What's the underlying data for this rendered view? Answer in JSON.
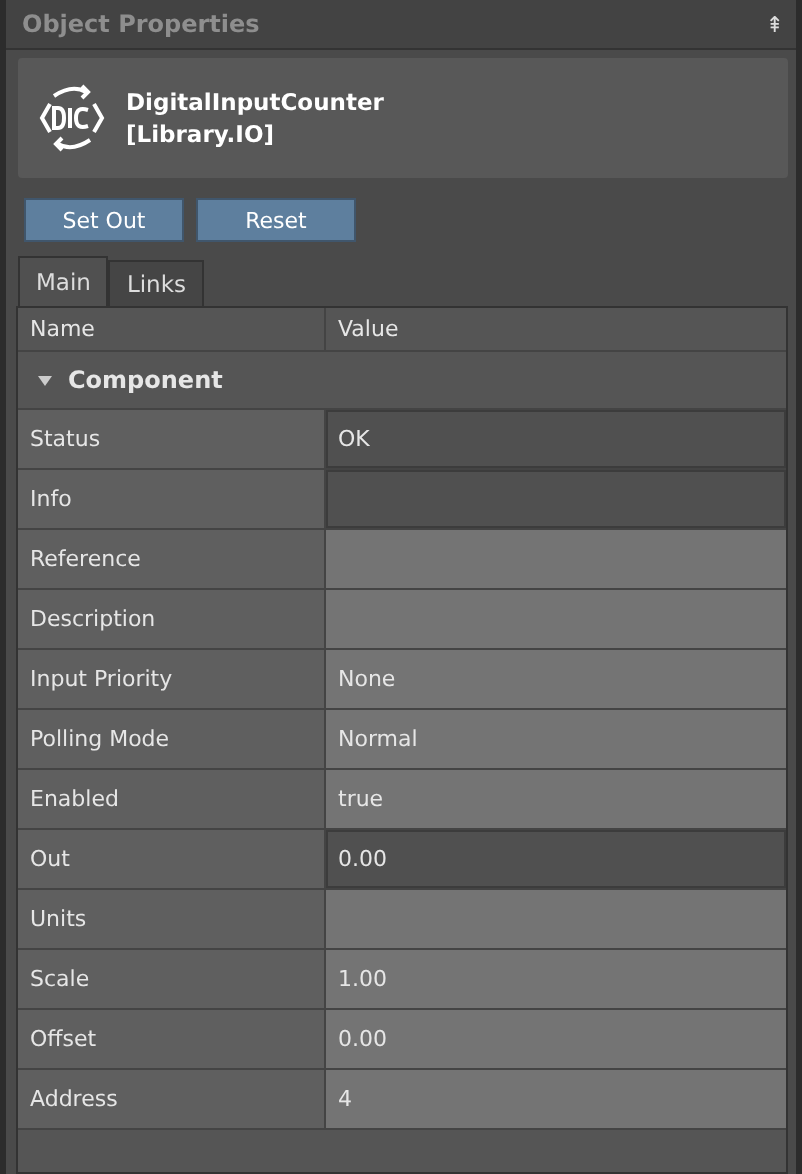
{
  "panel": {
    "title": "Object Properties",
    "pin": "⇞"
  },
  "header": {
    "name": "DigitalInputCounter",
    "library": "[Library.IO]"
  },
  "buttons": [
    "Set Out",
    "Reset"
  ],
  "tabs": [
    {
      "label": "Main",
      "selected": true
    },
    {
      "label": "Links",
      "selected": false
    }
  ],
  "table": {
    "columns": [
      "Name",
      "Value"
    ],
    "group": {
      "label": "Component",
      "expanded": true
    },
    "rows": [
      {
        "name": "Status",
        "value": "OK",
        "editable": false
      },
      {
        "name": "Info",
        "editable": false
      },
      {
        "name": "Reference",
        "editable": true
      },
      {
        "name": "Description",
        "editable": true
      },
      {
        "name": "Input Priority",
        "value": "None",
        "editable": true
      },
      {
        "name": "Polling Mode",
        "value": "Normal",
        "editable": true
      },
      {
        "name": "Enabled",
        "value": "true",
        "editable": true
      },
      {
        "name": "Out",
        "value": "0.00",
        "editable": false
      },
      {
        "name": "Units",
        "editable": true
      },
      {
        "name": "Scale",
        "value": "1.00",
        "editable": true
      },
      {
        "name": "Offset",
        "value": "0.00",
        "editable": true
      },
      {
        "name": "Address",
        "value": "4",
        "editable": true
      }
    ]
  }
}
